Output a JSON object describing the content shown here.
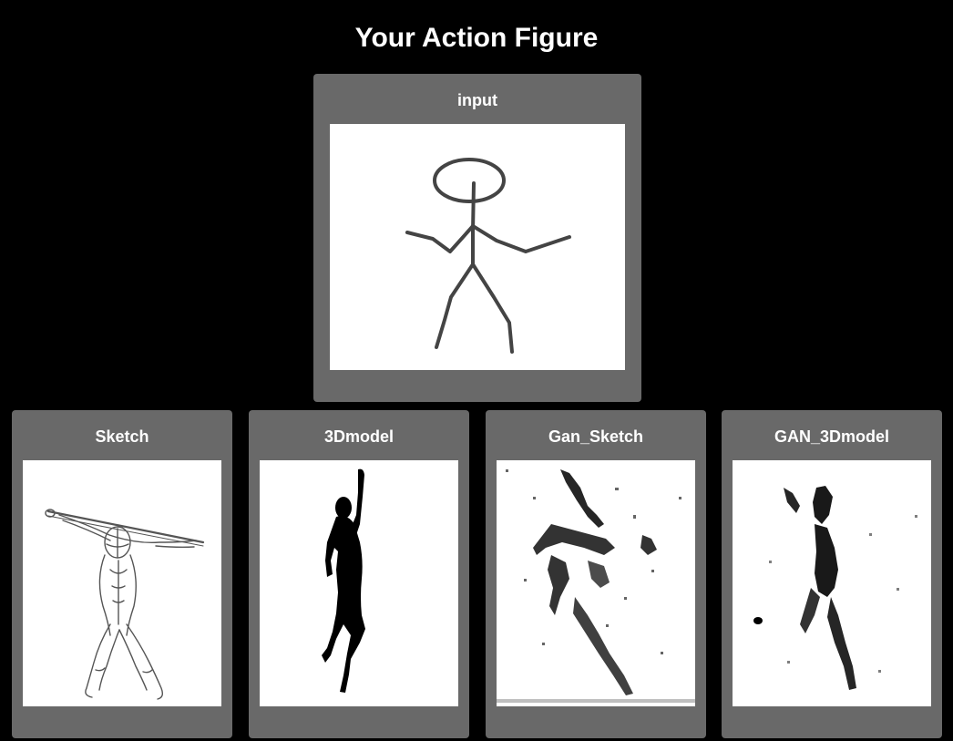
{
  "page": {
    "title": "Your Action Figure"
  },
  "cards": {
    "input": {
      "label": "input",
      "image": "stick-figure-drawing"
    },
    "sketch": {
      "label": "Sketch",
      "image": "muscular-figure-sketch"
    },
    "model3d": {
      "label": "3Dmodel",
      "image": "silhouette-figure"
    },
    "gan_sketch": {
      "label": "Gan_Sketch",
      "image": "noisy-gan-sketch"
    },
    "gan_3d": {
      "label": "GAN_3Dmodel",
      "image": "noisy-gan-silhouette"
    }
  },
  "colors": {
    "background": "#000000",
    "card": "#696969",
    "text": "#ffffff",
    "image_bg": "#ffffff",
    "stroke": "#444444"
  }
}
